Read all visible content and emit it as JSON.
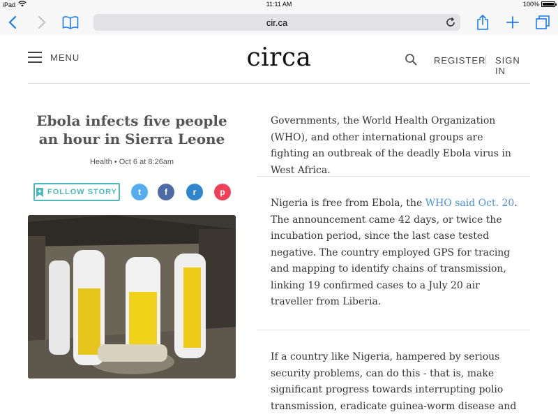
{
  "status_bar": {
    "device": "iPad",
    "time": "11:11 AM",
    "battery": "100%"
  },
  "browser": {
    "url": "cir.ca"
  },
  "header": {
    "menu_label": "MENU",
    "logo": "circa",
    "register_label": "REGISTER",
    "signin_label": "SIGN IN"
  },
  "story": {
    "title": "Ebola infects five people an hour in Sierra Leone",
    "meta": "Health • Oct 6 at 8:26am",
    "follow_label": "FOLLOW STORY",
    "share_buttons": [
      {
        "icon": "twitter-icon",
        "glyph": "t",
        "color": "#55acee"
      },
      {
        "icon": "facebook-icon",
        "glyph": "f",
        "color": "#4e6aa5"
      },
      {
        "icon": "reddit-icon",
        "glyph": "r",
        "color": "#2f86cd"
      },
      {
        "icon": "pocket-icon",
        "glyph": "p",
        "color": "#ee4056"
      }
    ]
  },
  "points": [
    {
      "text": "Governments, the World Health Organization (WHO), and other international groups are fighting an outbreak of the deadly Ebola virus in West Africa."
    },
    {
      "before": "Nigeria is free from Ebola, the ",
      "link": "WHO said Oct. 20",
      "after": ". The announcement came 42 days, or twice the incubation period, since the last case tested negative. The country employed GPS for tracing and mapping to identify chains of transmission, linking 19 confirmed cases to a July 20 air traveller from Liberia."
    },
    {
      "text": "If a country like Nigeria, hampered by serious security problems, can do this - that is, make significant progress towards interrupting polio transmission, eradicate guinea-worm disease and"
    }
  ],
  "colors": {
    "accent": "#4fb8bd",
    "link": "#4a90d9",
    "ios_blue": "#1a7cf5"
  }
}
